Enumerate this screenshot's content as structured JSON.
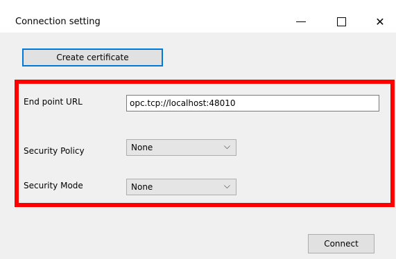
{
  "window": {
    "title": "Connection setting",
    "controls": {
      "minimize": "minimize-icon",
      "maximize": "maximize-icon",
      "close_label": "✕"
    }
  },
  "actions": {
    "create_certificate_label": "Create certificate",
    "connect_label": "Connect"
  },
  "form": {
    "endpoint_label": "End point URL",
    "endpoint_value": "opc.tcp://localhost:48010",
    "security_policy_label": "Security Policy",
    "security_policy_value": "None",
    "security_mode_label": "Security Mode",
    "security_mode_value": "None"
  },
  "icons": {
    "dropdown": "chevron-down-icon"
  },
  "colors": {
    "highlight_border": "#ff0000",
    "focus_border": "#0078d7"
  }
}
